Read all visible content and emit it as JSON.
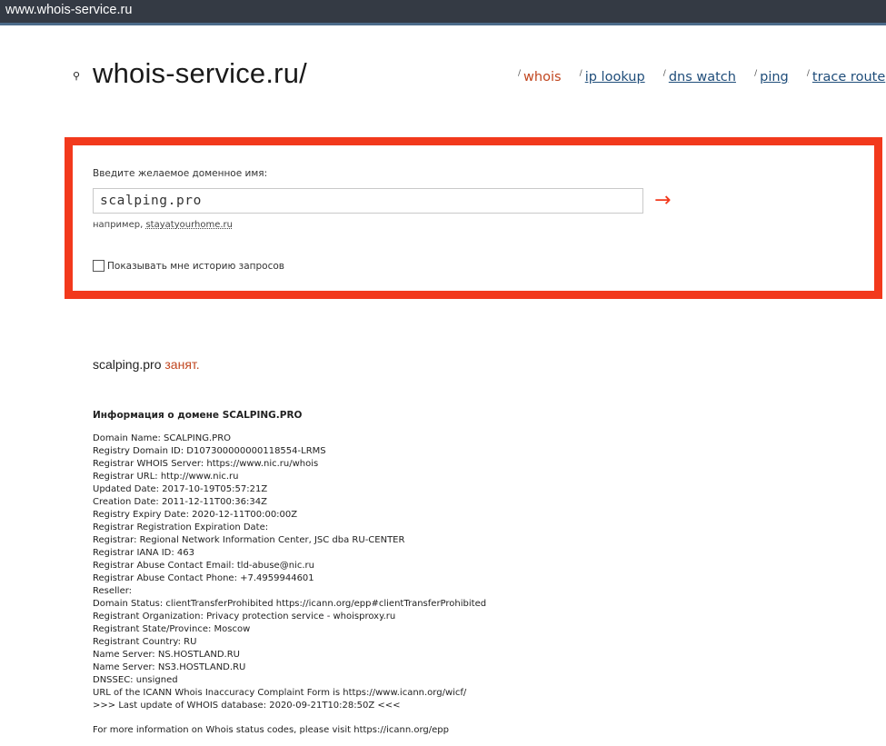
{
  "browser": {
    "url": "www.whois-service.ru"
  },
  "header": {
    "logo_text": "whois-service.ru/",
    "nav": [
      {
        "label": "whois"
      },
      {
        "label": "ip lookup"
      },
      {
        "label": "dns watch"
      },
      {
        "label": "ping"
      },
      {
        "label": "trace route"
      },
      {
        "label": "v"
      }
    ]
  },
  "search": {
    "prompt": "Введите желаемое доменное имя:",
    "value": "scalping.pro",
    "submit_glyph": "→",
    "example_prefix": "например,",
    "example_link": "stayatyourhome.ru",
    "history_label": "Показывать мне историю запросов"
  },
  "result": {
    "domain": "scalping.pro",
    "status": "занят.",
    "info_heading": "Информация о домене SCALPING.PRO",
    "whois_lines": [
      "Domain Name: SCALPING.PRO",
      "Registry Domain ID: D107300000000118554-LRMS",
      "Registrar WHOIS Server: https://www.nic.ru/whois",
      "Registrar URL: http://www.nic.ru",
      "Updated Date: 2017-10-19T05:57:21Z",
      "Creation Date: 2011-12-11T00:36:34Z",
      "Registry Expiry Date: 2020-12-11T00:00:00Z",
      "Registrar Registration Expiration Date:",
      "Registrar: Regional Network Information Center, JSC dba RU-CENTER",
      "Registrar IANA ID: 463",
      "Registrar Abuse Contact Email: tld-abuse@nic.ru",
      "Registrar Abuse Contact Phone: +7.4959944601",
      "Reseller:",
      "Domain Status: clientTransferProhibited https://icann.org/epp#clientTransferProhibited",
      "Registrant Organization: Privacy protection service - whoisproxy.ru",
      "Registrant State/Province: Moscow",
      "Registrant Country: RU",
      "Name Server: NS.HOSTLAND.RU",
      "Name Server: NS3.HOSTLAND.RU",
      "DNSSEC: unsigned",
      "URL of the ICANN Whois Inaccuracy Complaint Form is https://www.icann.org/wicf/",
      ">>> Last update of WHOIS database: 2020-09-21T10:28:50Z <<<"
    ],
    "footer": "For more information on Whois status codes, please visit https://icann.org/epp"
  },
  "colors": {
    "accent": "#f2391c",
    "link": "#1f4d7a",
    "active_link": "#c1461f"
  }
}
